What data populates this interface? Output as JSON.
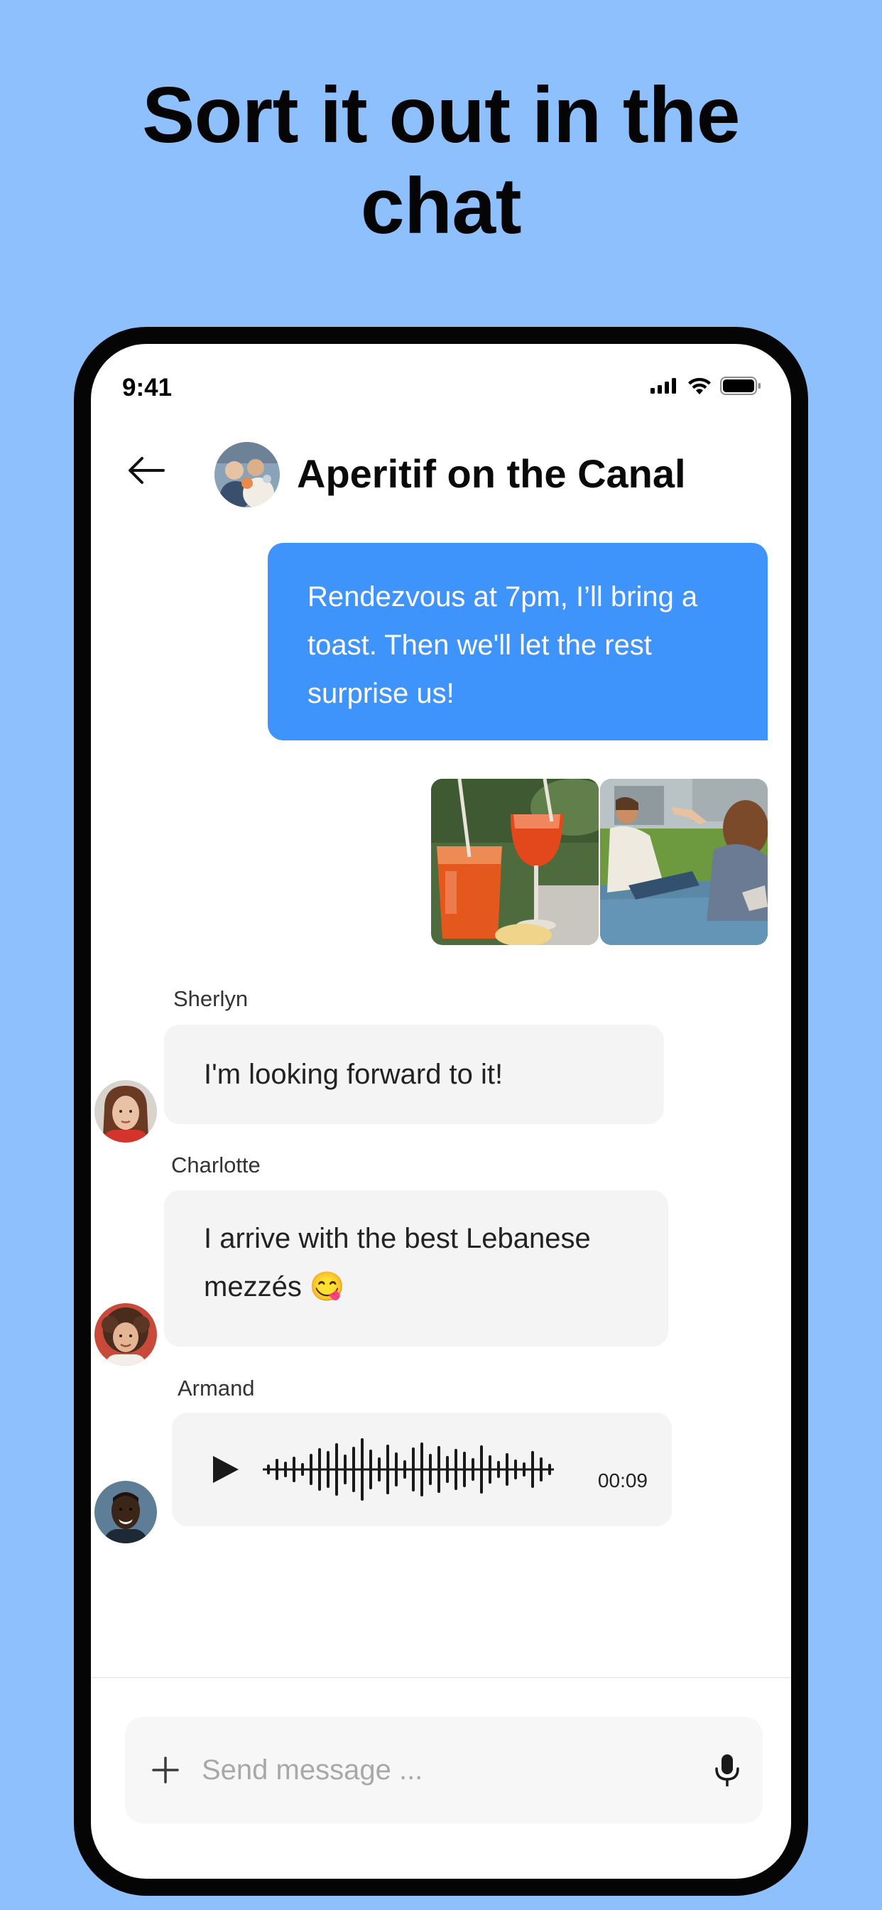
{
  "headline": {
    "line1": "Sort it out in the",
    "line2": "chat"
  },
  "status_bar": {
    "time": "9:41",
    "icons": [
      "cellular-signal-icon",
      "wifi-icon",
      "battery-icon"
    ]
  },
  "chat_header": {
    "back_icon": "arrow-left-icon",
    "title": "Aperitif on the Canal"
  },
  "messages": {
    "outgoing": {
      "text": "Rendezvous at 7pm, I’ll bring a toast. Then we'll let the rest surprise us!"
    },
    "shared_photos": [
      "spritz-drinks-photo",
      "picnic-friends-photo"
    ],
    "sherlyn": {
      "sender": "Sherlyn",
      "text": "I'm looking forward to it!"
    },
    "charlotte": {
      "sender": "Charlotte",
      "line1": "I arrive with the best Lebanese",
      "line2": "mezzés 😋"
    },
    "armand": {
      "sender": "Armand",
      "voice_duration": "00:09",
      "play_icon": "play-icon"
    }
  },
  "composer": {
    "placeholder": "Send message ...",
    "add_icon": "plus-icon",
    "mic_icon": "microphone-icon"
  },
  "colors": {
    "background": "#8ec0fe",
    "outgoing_bubble": "#3f94fb",
    "incoming_bubble": "#f4f4f4",
    "phone_frame": "#050505"
  }
}
